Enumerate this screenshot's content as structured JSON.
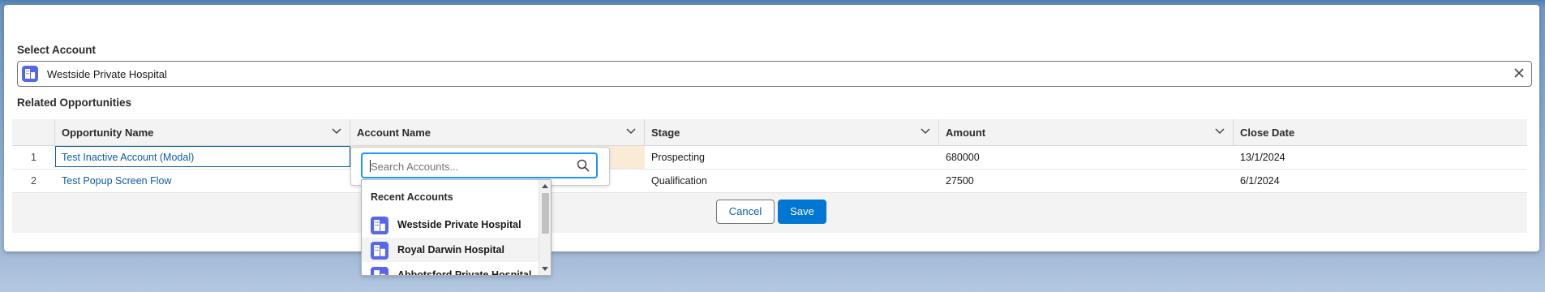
{
  "select_account": {
    "label": "Select Account",
    "selected_value": "Westside Private Hospital",
    "icon": "account-icon"
  },
  "related": {
    "label": "Related Opportunities",
    "columns": [
      "Opportunity Name",
      "Account Name",
      "Stage",
      "Amount",
      "Close Date"
    ],
    "rows": [
      {
        "num": "1",
        "opportunity": "Test Inactive Account (Modal)",
        "account": "",
        "stage": "Prospecting",
        "amount": "680000",
        "close_date": "13/1/2024"
      },
      {
        "num": "2",
        "opportunity": "Test Popup Screen Flow",
        "account": "",
        "stage": "Qualification",
        "amount": "27500",
        "close_date": "6/1/2024"
      }
    ]
  },
  "buttons": {
    "cancel": "Cancel",
    "save": "Save"
  },
  "account_search": {
    "placeholder": "Search Accounts...",
    "heading": "Recent Accounts",
    "items": [
      "Westside Private Hospital",
      "Royal Darwin Hospital",
      "Abbotsford Private Hospital"
    ]
  },
  "colors": {
    "brand": "#0176d3",
    "link": "#0b5cab",
    "account_icon": "#5867e8",
    "edited_cell": "#faebd7",
    "focus_ring": "#1b96ff"
  }
}
